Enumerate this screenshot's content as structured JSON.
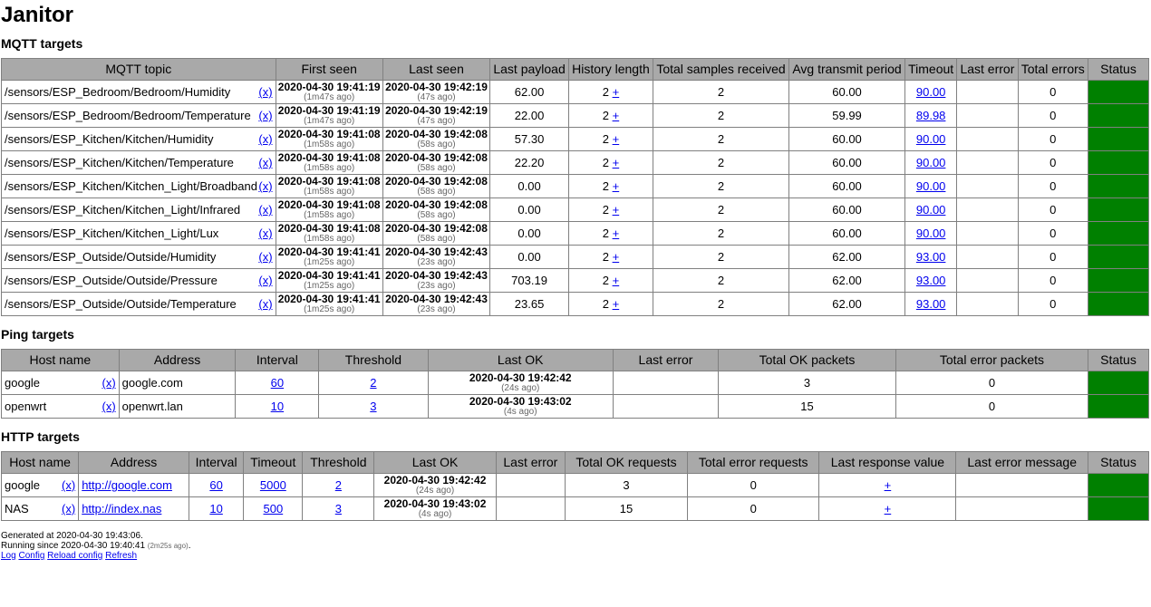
{
  "title": "Janitor",
  "mqtt": {
    "heading": "MQTT targets",
    "headers": [
      "MQTT topic",
      "First seen",
      "Last seen",
      "Last payload",
      "History length",
      "Total samples received",
      "Avg transmit period",
      "Timeout",
      "Last error",
      "Total errors",
      "Status"
    ],
    "remove_label": "(x)",
    "plus_label": "+",
    "rows": [
      {
        "topic": "/sensors/ESP_Bedroom/Bedroom/Humidity",
        "first": "2020-04-30 19:41:19",
        "first_ago": "(1m47s ago)",
        "last": "2020-04-30 19:42:19",
        "last_ago": "(47s ago)",
        "payload": "62.00",
        "history": "2",
        "samples": "2",
        "period": "60.00",
        "timeout": "90.00",
        "last_error": "",
        "errors": "0",
        "status": "ok"
      },
      {
        "topic": "/sensors/ESP_Bedroom/Bedroom/Temperature",
        "first": "2020-04-30 19:41:19",
        "first_ago": "(1m47s ago)",
        "last": "2020-04-30 19:42:19",
        "last_ago": "(47s ago)",
        "payload": "22.00",
        "history": "2",
        "samples": "2",
        "period": "59.99",
        "timeout": "89.98",
        "last_error": "",
        "errors": "0",
        "status": "ok"
      },
      {
        "topic": "/sensors/ESP_Kitchen/Kitchen/Humidity",
        "first": "2020-04-30 19:41:08",
        "first_ago": "(1m58s ago)",
        "last": "2020-04-30 19:42:08",
        "last_ago": "(58s ago)",
        "payload": "57.30",
        "history": "2",
        "samples": "2",
        "period": "60.00",
        "timeout": "90.00",
        "last_error": "",
        "errors": "0",
        "status": "ok"
      },
      {
        "topic": "/sensors/ESP_Kitchen/Kitchen/Temperature",
        "first": "2020-04-30 19:41:08",
        "first_ago": "(1m58s ago)",
        "last": "2020-04-30 19:42:08",
        "last_ago": "(58s ago)",
        "payload": "22.20",
        "history": "2",
        "samples": "2",
        "period": "60.00",
        "timeout": "90.00",
        "last_error": "",
        "errors": "0",
        "status": "ok"
      },
      {
        "topic": "/sensors/ESP_Kitchen/Kitchen_Light/Broadband",
        "first": "2020-04-30 19:41:08",
        "first_ago": "(1m58s ago)",
        "last": "2020-04-30 19:42:08",
        "last_ago": "(58s ago)",
        "payload": "0.00",
        "history": "2",
        "samples": "2",
        "period": "60.00",
        "timeout": "90.00",
        "last_error": "",
        "errors": "0",
        "status": "ok"
      },
      {
        "topic": "/sensors/ESP_Kitchen/Kitchen_Light/Infrared",
        "first": "2020-04-30 19:41:08",
        "first_ago": "(1m58s ago)",
        "last": "2020-04-30 19:42:08",
        "last_ago": "(58s ago)",
        "payload": "0.00",
        "history": "2",
        "samples": "2",
        "period": "60.00",
        "timeout": "90.00",
        "last_error": "",
        "errors": "0",
        "status": "ok"
      },
      {
        "topic": "/sensors/ESP_Kitchen/Kitchen_Light/Lux",
        "first": "2020-04-30 19:41:08",
        "first_ago": "(1m58s ago)",
        "last": "2020-04-30 19:42:08",
        "last_ago": "(58s ago)",
        "payload": "0.00",
        "history": "2",
        "samples": "2",
        "period": "60.00",
        "timeout": "90.00",
        "last_error": "",
        "errors": "0",
        "status": "ok"
      },
      {
        "topic": "/sensors/ESP_Outside/Outside/Humidity",
        "first": "2020-04-30 19:41:41",
        "first_ago": "(1m25s ago)",
        "last": "2020-04-30 19:42:43",
        "last_ago": "(23s ago)",
        "payload": "0.00",
        "history": "2",
        "samples": "2",
        "period": "62.00",
        "timeout": "93.00",
        "last_error": "",
        "errors": "0",
        "status": "ok"
      },
      {
        "topic": "/sensors/ESP_Outside/Outside/Pressure",
        "first": "2020-04-30 19:41:41",
        "first_ago": "(1m25s ago)",
        "last": "2020-04-30 19:42:43",
        "last_ago": "(23s ago)",
        "payload": "703.19",
        "history": "2",
        "samples": "2",
        "period": "62.00",
        "timeout": "93.00",
        "last_error": "",
        "errors": "0",
        "status": "ok"
      },
      {
        "topic": "/sensors/ESP_Outside/Outside/Temperature",
        "first": "2020-04-30 19:41:41",
        "first_ago": "(1m25s ago)",
        "last": "2020-04-30 19:42:43",
        "last_ago": "(23s ago)",
        "payload": "23.65",
        "history": "2",
        "samples": "2",
        "period": "62.00",
        "timeout": "93.00",
        "last_error": "",
        "errors": "0",
        "status": "ok"
      }
    ]
  },
  "ping": {
    "heading": "Ping targets",
    "headers": [
      "Host name",
      "Address",
      "Interval",
      "Threshold",
      "Last OK",
      "Last error",
      "Total OK packets",
      "Total error packets",
      "Status"
    ],
    "remove_label": "(x)",
    "rows": [
      {
        "host": "google",
        "address": "google.com",
        "interval": "60",
        "threshold": "2",
        "last_ok": "2020-04-30 19:42:42",
        "last_ok_ago": "(24s ago)",
        "last_error": "",
        "ok": "3",
        "err": "0",
        "status": "ok"
      },
      {
        "host": "openwrt",
        "address": "openwrt.lan",
        "interval": "10",
        "threshold": "3",
        "last_ok": "2020-04-30 19:43:02",
        "last_ok_ago": "(4s ago)",
        "last_error": "",
        "ok": "15",
        "err": "0",
        "status": "ok"
      }
    ]
  },
  "http": {
    "heading": "HTTP targets",
    "headers": [
      "Host name",
      "Address",
      "Interval",
      "Timeout",
      "Threshold",
      "Last OK",
      "Last error",
      "Total OK requests",
      "Total error requests",
      "Last response value",
      "Last error message",
      "Status"
    ],
    "remove_label": "(x)",
    "plus_label": "+",
    "rows": [
      {
        "host": "google",
        "address": "http://google.com",
        "interval": "60",
        "timeout": "5000",
        "threshold": "2",
        "last_ok": "2020-04-30 19:42:42",
        "last_ok_ago": "(24s ago)",
        "last_error": "",
        "ok": "3",
        "err": "0",
        "last_error_message": "",
        "status": "ok"
      },
      {
        "host": "NAS",
        "address": "http://index.nas",
        "interval": "10",
        "timeout": "500",
        "threshold": "3",
        "last_ok": "2020-04-30 19:43:02",
        "last_ok_ago": "(4s ago)",
        "last_error": "",
        "ok": "15",
        "err": "0",
        "last_error_message": "",
        "status": "ok"
      }
    ]
  },
  "footer": {
    "generated": "Generated at 2020-04-30 19:43:06.",
    "running": "Running since 2020-04-30 19:40:41",
    "running_ago": "(2m25s ago)",
    "running_end": ".",
    "links": [
      "Log",
      "Config",
      "Reload config",
      "Refresh"
    ]
  },
  "colors": {
    "status_ok": "#008000",
    "header_bg": "#a9a9a9",
    "link": "#0000ee"
  }
}
